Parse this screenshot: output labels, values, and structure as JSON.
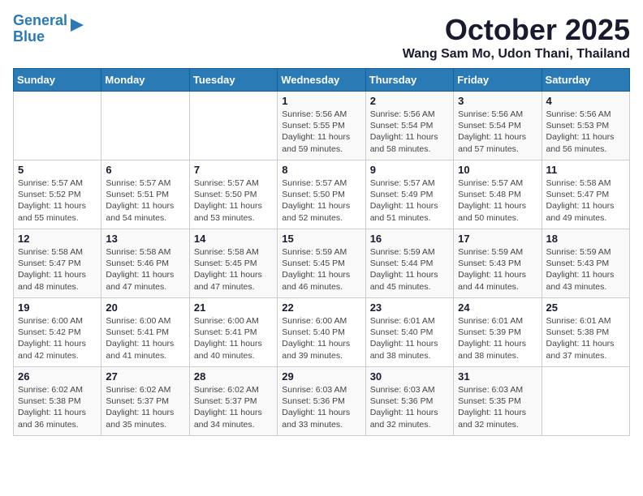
{
  "logo": {
    "line1": "General",
    "line2": "Blue"
  },
  "title": "October 2025",
  "location": "Wang Sam Mo, Udon Thani, Thailand",
  "days_of_week": [
    "Sunday",
    "Monday",
    "Tuesday",
    "Wednesday",
    "Thursday",
    "Friday",
    "Saturday"
  ],
  "weeks": [
    [
      {
        "date": "",
        "info": ""
      },
      {
        "date": "",
        "info": ""
      },
      {
        "date": "",
        "info": ""
      },
      {
        "date": "1",
        "info": "Sunrise: 5:56 AM\nSunset: 5:55 PM\nDaylight: 11 hours\nand 59 minutes."
      },
      {
        "date": "2",
        "info": "Sunrise: 5:56 AM\nSunset: 5:54 PM\nDaylight: 11 hours\nand 58 minutes."
      },
      {
        "date": "3",
        "info": "Sunrise: 5:56 AM\nSunset: 5:54 PM\nDaylight: 11 hours\nand 57 minutes."
      },
      {
        "date": "4",
        "info": "Sunrise: 5:56 AM\nSunset: 5:53 PM\nDaylight: 11 hours\nand 56 minutes."
      }
    ],
    [
      {
        "date": "5",
        "info": "Sunrise: 5:57 AM\nSunset: 5:52 PM\nDaylight: 11 hours\nand 55 minutes."
      },
      {
        "date": "6",
        "info": "Sunrise: 5:57 AM\nSunset: 5:51 PM\nDaylight: 11 hours\nand 54 minutes."
      },
      {
        "date": "7",
        "info": "Sunrise: 5:57 AM\nSunset: 5:50 PM\nDaylight: 11 hours\nand 53 minutes."
      },
      {
        "date": "8",
        "info": "Sunrise: 5:57 AM\nSunset: 5:50 PM\nDaylight: 11 hours\nand 52 minutes."
      },
      {
        "date": "9",
        "info": "Sunrise: 5:57 AM\nSunset: 5:49 PM\nDaylight: 11 hours\nand 51 minutes."
      },
      {
        "date": "10",
        "info": "Sunrise: 5:57 AM\nSunset: 5:48 PM\nDaylight: 11 hours\nand 50 minutes."
      },
      {
        "date": "11",
        "info": "Sunrise: 5:58 AM\nSunset: 5:47 PM\nDaylight: 11 hours\nand 49 minutes."
      }
    ],
    [
      {
        "date": "12",
        "info": "Sunrise: 5:58 AM\nSunset: 5:47 PM\nDaylight: 11 hours\nand 48 minutes."
      },
      {
        "date": "13",
        "info": "Sunrise: 5:58 AM\nSunset: 5:46 PM\nDaylight: 11 hours\nand 47 minutes."
      },
      {
        "date": "14",
        "info": "Sunrise: 5:58 AM\nSunset: 5:45 PM\nDaylight: 11 hours\nand 47 minutes."
      },
      {
        "date": "15",
        "info": "Sunrise: 5:59 AM\nSunset: 5:45 PM\nDaylight: 11 hours\nand 46 minutes."
      },
      {
        "date": "16",
        "info": "Sunrise: 5:59 AM\nSunset: 5:44 PM\nDaylight: 11 hours\nand 45 minutes."
      },
      {
        "date": "17",
        "info": "Sunrise: 5:59 AM\nSunset: 5:43 PM\nDaylight: 11 hours\nand 44 minutes."
      },
      {
        "date": "18",
        "info": "Sunrise: 5:59 AM\nSunset: 5:43 PM\nDaylight: 11 hours\nand 43 minutes."
      }
    ],
    [
      {
        "date": "19",
        "info": "Sunrise: 6:00 AM\nSunset: 5:42 PM\nDaylight: 11 hours\nand 42 minutes."
      },
      {
        "date": "20",
        "info": "Sunrise: 6:00 AM\nSunset: 5:41 PM\nDaylight: 11 hours\nand 41 minutes."
      },
      {
        "date": "21",
        "info": "Sunrise: 6:00 AM\nSunset: 5:41 PM\nDaylight: 11 hours\nand 40 minutes."
      },
      {
        "date": "22",
        "info": "Sunrise: 6:00 AM\nSunset: 5:40 PM\nDaylight: 11 hours\nand 39 minutes."
      },
      {
        "date": "23",
        "info": "Sunrise: 6:01 AM\nSunset: 5:40 PM\nDaylight: 11 hours\nand 38 minutes."
      },
      {
        "date": "24",
        "info": "Sunrise: 6:01 AM\nSunset: 5:39 PM\nDaylight: 11 hours\nand 38 minutes."
      },
      {
        "date": "25",
        "info": "Sunrise: 6:01 AM\nSunset: 5:38 PM\nDaylight: 11 hours\nand 37 minutes."
      }
    ],
    [
      {
        "date": "26",
        "info": "Sunrise: 6:02 AM\nSunset: 5:38 PM\nDaylight: 11 hours\nand 36 minutes."
      },
      {
        "date": "27",
        "info": "Sunrise: 6:02 AM\nSunset: 5:37 PM\nDaylight: 11 hours\nand 35 minutes."
      },
      {
        "date": "28",
        "info": "Sunrise: 6:02 AM\nSunset: 5:37 PM\nDaylight: 11 hours\nand 34 minutes."
      },
      {
        "date": "29",
        "info": "Sunrise: 6:03 AM\nSunset: 5:36 PM\nDaylight: 11 hours\nand 33 minutes."
      },
      {
        "date": "30",
        "info": "Sunrise: 6:03 AM\nSunset: 5:36 PM\nDaylight: 11 hours\nand 32 minutes."
      },
      {
        "date": "31",
        "info": "Sunrise: 6:03 AM\nSunset: 5:35 PM\nDaylight: 11 hours\nand 32 minutes."
      },
      {
        "date": "",
        "info": ""
      }
    ]
  ]
}
